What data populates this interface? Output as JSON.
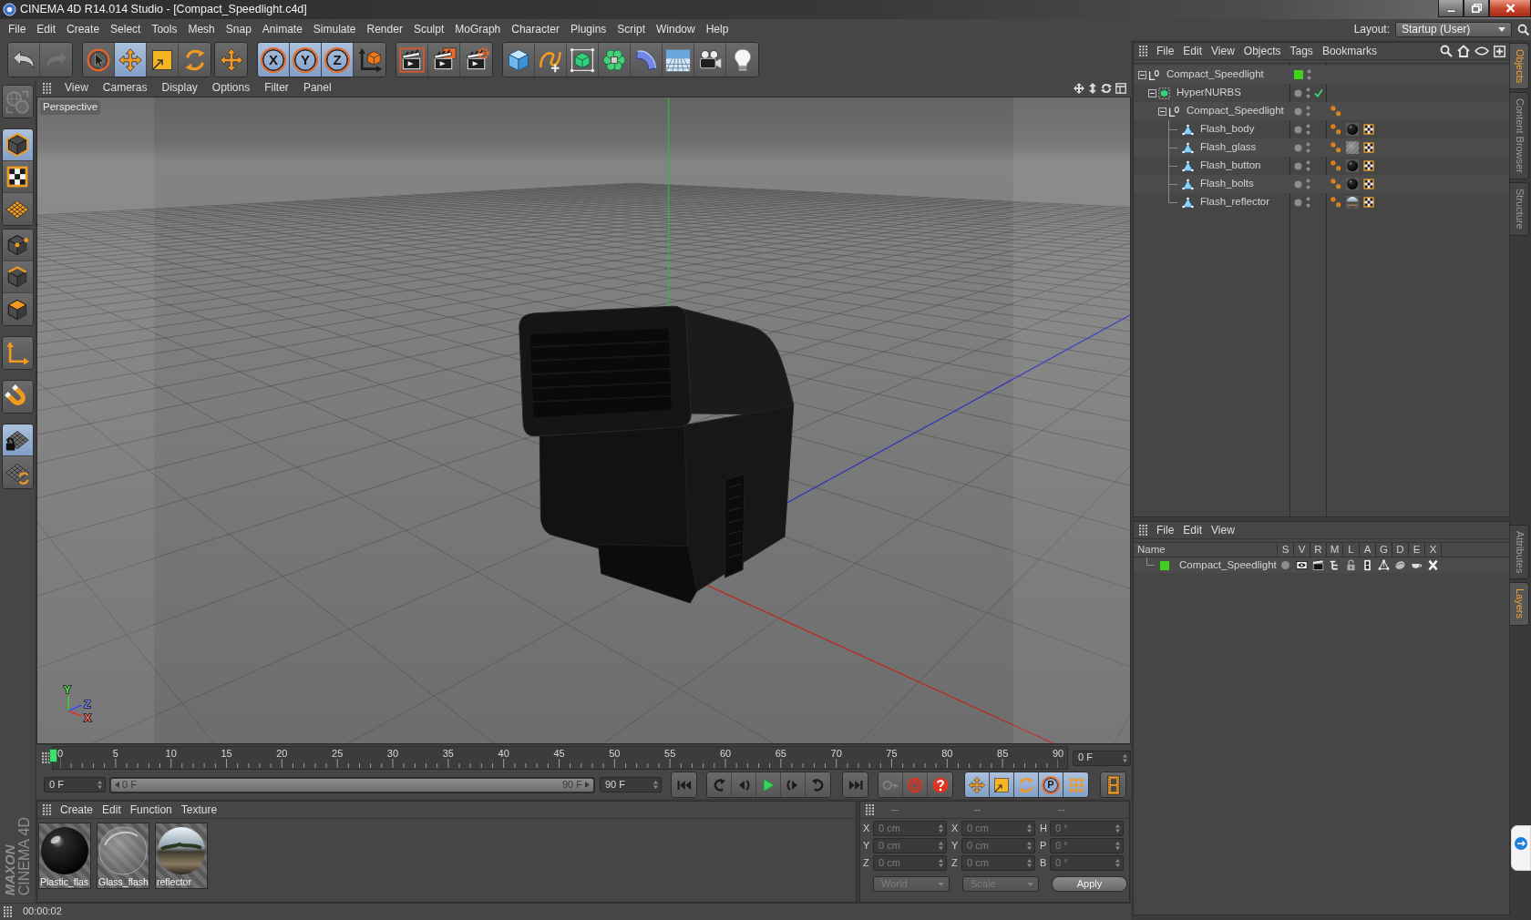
{
  "window": {
    "title": "CINEMA 4D R14.014 Studio - [Compact_Speedlight.c4d]"
  },
  "menu_bar": [
    "File",
    "Edit",
    "Create",
    "Select",
    "Tools",
    "Mesh",
    "Snap",
    "Animate",
    "Simulate",
    "Render",
    "Sculpt",
    "MoGraph",
    "Character",
    "Plugins",
    "Script",
    "Window",
    "Help"
  ],
  "layout": {
    "label": "Layout:",
    "value": "Startup (User)"
  },
  "toolbar": [
    [
      {
        "kind": "undo",
        "active": false,
        "disabled": false
      },
      {
        "kind": "redo",
        "active": false,
        "disabled": true
      }
    ],
    [
      {
        "kind": "select",
        "active": false
      },
      {
        "kind": "move",
        "active": true
      },
      {
        "kind": "scale",
        "active": false
      },
      {
        "kind": "rotate",
        "active": false
      }
    ],
    [
      {
        "kind": "recent",
        "active": false
      }
    ],
    [
      {
        "kind": "axis",
        "label": "X",
        "active": true
      },
      {
        "kind": "axis",
        "label": "Y",
        "active": true
      },
      {
        "kind": "axis",
        "label": "Z",
        "active": true
      },
      {
        "kind": "world",
        "active": false
      }
    ],
    [
      {
        "kind": "render_view",
        "active": false
      },
      {
        "kind": "render",
        "active": false
      },
      {
        "kind": "render_settings",
        "active": false
      }
    ],
    [
      {
        "kind": "cube",
        "active": false
      },
      {
        "kind": "spline",
        "active": false
      },
      {
        "kind": "subdivision",
        "active": false
      },
      {
        "kind": "array",
        "active": false
      },
      {
        "kind": "bend",
        "active": false
      },
      {
        "kind": "floor",
        "active": false
      },
      {
        "kind": "camera",
        "active": false
      },
      {
        "kind": "light",
        "active": false
      }
    ]
  ],
  "mode_toolbar": [
    [
      {
        "kind": "convert",
        "active": false,
        "disabled": true
      }
    ],
    [
      {
        "kind": "model",
        "active": true
      },
      {
        "kind": "texture",
        "active": false
      },
      {
        "kind": "workplane",
        "active": false
      }
    ],
    [
      {
        "kind": "points",
        "active": false
      },
      {
        "kind": "edges",
        "active": false
      },
      {
        "kind": "polygons",
        "active": false
      }
    ],
    [
      {
        "kind": "axis_mode",
        "active": false
      }
    ],
    [
      {
        "kind": "snap",
        "active": false
      }
    ],
    [
      {
        "kind": "lock_workplane",
        "active": true
      },
      {
        "kind": "align_workplane",
        "active": false
      }
    ]
  ],
  "viewport": {
    "menu": [
      "View",
      "Cameras",
      "Display",
      "Options",
      "Filter",
      "Panel"
    ],
    "camera": "Perspective",
    "gizmo_labels": [
      "Y",
      "Z",
      "X"
    ]
  },
  "timeline": {
    "ticks": [
      "0",
      "5",
      "10",
      "15",
      "20",
      "25",
      "30",
      "35",
      "40",
      "45",
      "50",
      "55",
      "60",
      "65",
      "70",
      "75",
      "80",
      "85",
      "90"
    ],
    "playhead": {
      "level": 0
    },
    "current_frame": "0 F",
    "start": "0 F",
    "range": {
      "start": "0 F",
      "end": "90 F",
      "level": 1
    },
    "end": "90 F",
    "key_buttons": [
      {
        "kind": "record",
        "disabled": true
      },
      {
        "kind": "autokey",
        "disabled": false
      },
      {
        "kind": "key_selection",
        "disabled": false
      }
    ],
    "key_filters": [
      {
        "kind": "position",
        "active": true
      },
      {
        "kind": "scale",
        "active": true
      },
      {
        "kind": "rotation",
        "active": true
      },
      {
        "kind": "parameter",
        "label": "P",
        "active": true
      },
      {
        "kind": "point_level",
        "active": true
      }
    ]
  },
  "materials": {
    "menu": [
      "Create",
      "Edit",
      "Function",
      "Texture"
    ],
    "items": [
      {
        "name": "Plastic_flas",
        "kind": "plastic"
      },
      {
        "name": "Glass_flash",
        "kind": "glass"
      },
      {
        "name": "reflector",
        "kind": "mirror"
      }
    ]
  },
  "coordinates": {
    "disabled": true,
    "headers": [
      "--",
      "--",
      "--"
    ],
    "rows": [
      [
        {
          "axis": "X",
          "value": "0 cm"
        },
        {
          "axis": "X",
          "value": "0 cm"
        },
        {
          "axis": "H",
          "value": "0 °"
        }
      ],
      [
        {
          "axis": "Y",
          "value": "0 cm"
        },
        {
          "axis": "Y",
          "value": "0 cm"
        },
        {
          "axis": "P",
          "value": "0 °"
        }
      ],
      [
        {
          "axis": "Z",
          "value": "0 cm"
        },
        {
          "axis": "Z",
          "value": "0 cm"
        },
        {
          "axis": "B",
          "value": "0 °"
        }
      ]
    ],
    "dropdowns": [
      "World",
      "Scale"
    ],
    "apply": "Apply"
  },
  "status_bar": {
    "text": "00:00:02"
  },
  "brand": {
    "company": "MAXON",
    "product": "CINEMA 4D"
  },
  "objects": {
    "menu": [
      "File",
      "Edit",
      "View",
      "Objects",
      "Tags",
      "Bookmarks"
    ],
    "tree": [
      {
        "name": "Compact_Speedlight",
        "kind": "null",
        "color": "#3fd11f",
        "expanded": true,
        "children": [
          {
            "name": "HyperNURBS",
            "kind": "subdivision",
            "enabled": true,
            "expanded": true,
            "children": [
              {
                "name": "Compact_Speedlight",
                "kind": "null",
                "expanded": true,
                "tags": [
                  {
                    "kind": "phong"
                  }
                ],
                "children": [
                  {
                    "name": "Flash_body",
                    "kind": "polygon",
                    "tags": [
                      {
                        "kind": "phong"
                      },
                      {
                        "kind": "plastic"
                      },
                      {
                        "kind": "uvw"
                      }
                    ]
                  },
                  {
                    "name": "Flash_glass",
                    "kind": "polygon",
                    "tags": [
                      {
                        "kind": "phong"
                      },
                      {
                        "kind": "glass"
                      },
                      {
                        "kind": "uvw"
                      }
                    ]
                  },
                  {
                    "name": "Flash_button",
                    "kind": "polygon",
                    "tags": [
                      {
                        "kind": "phong"
                      },
                      {
                        "kind": "plastic"
                      },
                      {
                        "kind": "uvw"
                      }
                    ]
                  },
                  {
                    "name": "Flash_bolts",
                    "kind": "polygon",
                    "tags": [
                      {
                        "kind": "phong"
                      },
                      {
                        "kind": "plastic"
                      },
                      {
                        "kind": "uvw"
                      }
                    ]
                  },
                  {
                    "name": "Flash_reflector",
                    "kind": "polygon",
                    "tags": [
                      {
                        "kind": "phong"
                      },
                      {
                        "kind": "mirror"
                      },
                      {
                        "kind": "uvw"
                      }
                    ]
                  }
                ]
              }
            ]
          }
        ]
      }
    ]
  },
  "layers": {
    "menu": [
      "File",
      "Edit",
      "View"
    ],
    "columns": [
      "Name",
      "S",
      "V",
      "R",
      "M",
      "L",
      "A",
      "G",
      "D",
      "E",
      "X"
    ],
    "rows": [
      {
        "name": "Compact_Speedlight",
        "color": "#3fd11f",
        "switches": [
          {
            "kind": "solo",
            "on": false
          },
          {
            "kind": "view",
            "on": true
          },
          {
            "kind": "render",
            "on": true
          },
          {
            "kind": "manager",
            "on": true
          },
          {
            "kind": "lock",
            "on": false
          },
          {
            "kind": "animation",
            "on": true
          },
          {
            "kind": "generators",
            "on": true
          },
          {
            "kind": "deformers",
            "on": true
          },
          {
            "kind": "expressions",
            "on": true
          },
          {
            "kind": "xref",
            "on": true
          }
        ]
      }
    ]
  },
  "side_tabs": {
    "upper": [
      {
        "label": "Objects",
        "selected": true
      },
      {
        "label": "Content Browser",
        "selected": false
      },
      {
        "label": "Structure",
        "selected": false
      }
    ],
    "lower": [
      {
        "label": "Attributes",
        "selected": false
      },
      {
        "label": "Layers",
        "selected": true
      }
    ]
  }
}
